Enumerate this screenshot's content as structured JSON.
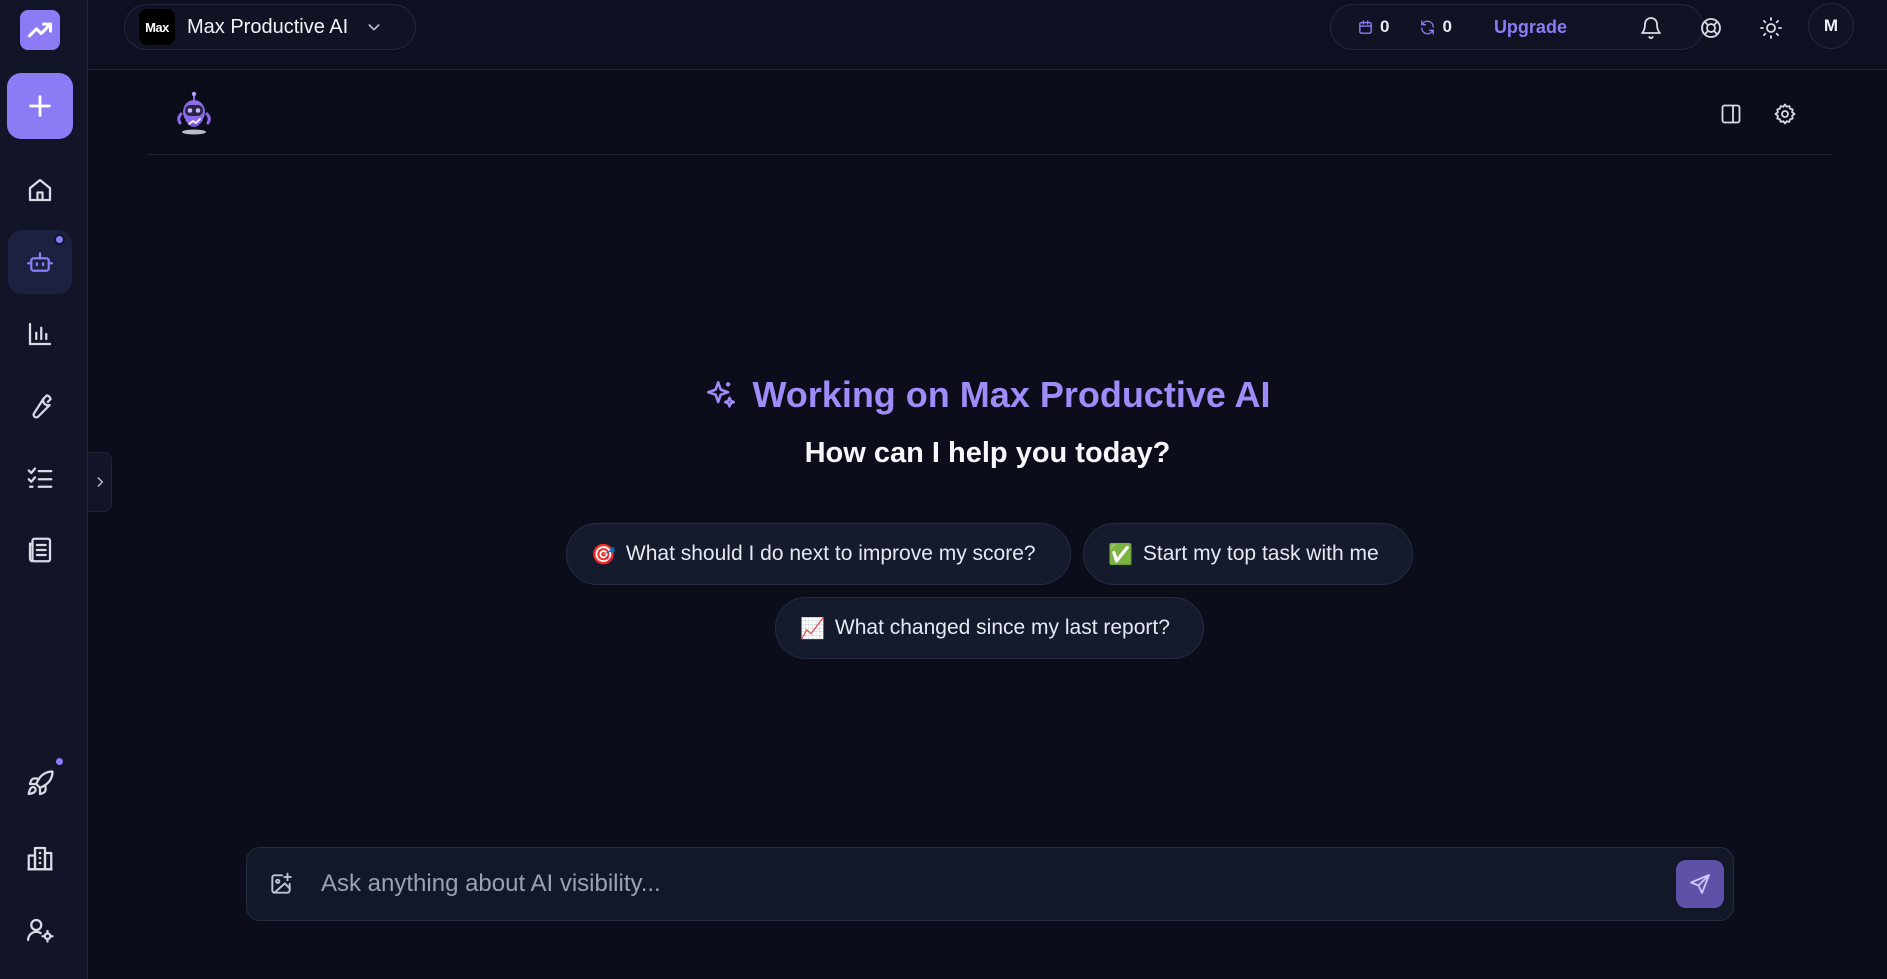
{
  "workspace": {
    "avatar_text": "Max",
    "name": "Max Productive AI"
  },
  "credits": {
    "calendar_count": "0",
    "refresh_count": "0",
    "upgrade_label": "Upgrade"
  },
  "user": {
    "initial": "M"
  },
  "hero": {
    "title": "Working on Max Productive AI",
    "subtitle": "How can I help you today?"
  },
  "suggestions": [
    {
      "emoji": "🎯",
      "label": "What should I do next to improve my score?"
    },
    {
      "emoji": "✅",
      "label": "Start my top task with me"
    },
    {
      "emoji": "📈",
      "label": "What changed since my last report?"
    }
  ],
  "composer": {
    "placeholder": "Ask anything about AI visibility..."
  },
  "colors": {
    "accent": "#8b7cf6",
    "background": "#0b0d1a",
    "sidebar": "#111527"
  },
  "icons": {
    "sidebar": [
      "logo-chart-icon",
      "plus-icon",
      "home-icon",
      "bot-icon",
      "bar-chart-icon",
      "wrench-icon",
      "checklist-icon",
      "report-icon",
      "rocket-icon",
      "buildings-icon",
      "user-settings-icon"
    ],
    "top": [
      "calendar-icon",
      "refresh-icon",
      "bell-icon",
      "lifebuoy-icon",
      "sun-icon"
    ]
  }
}
